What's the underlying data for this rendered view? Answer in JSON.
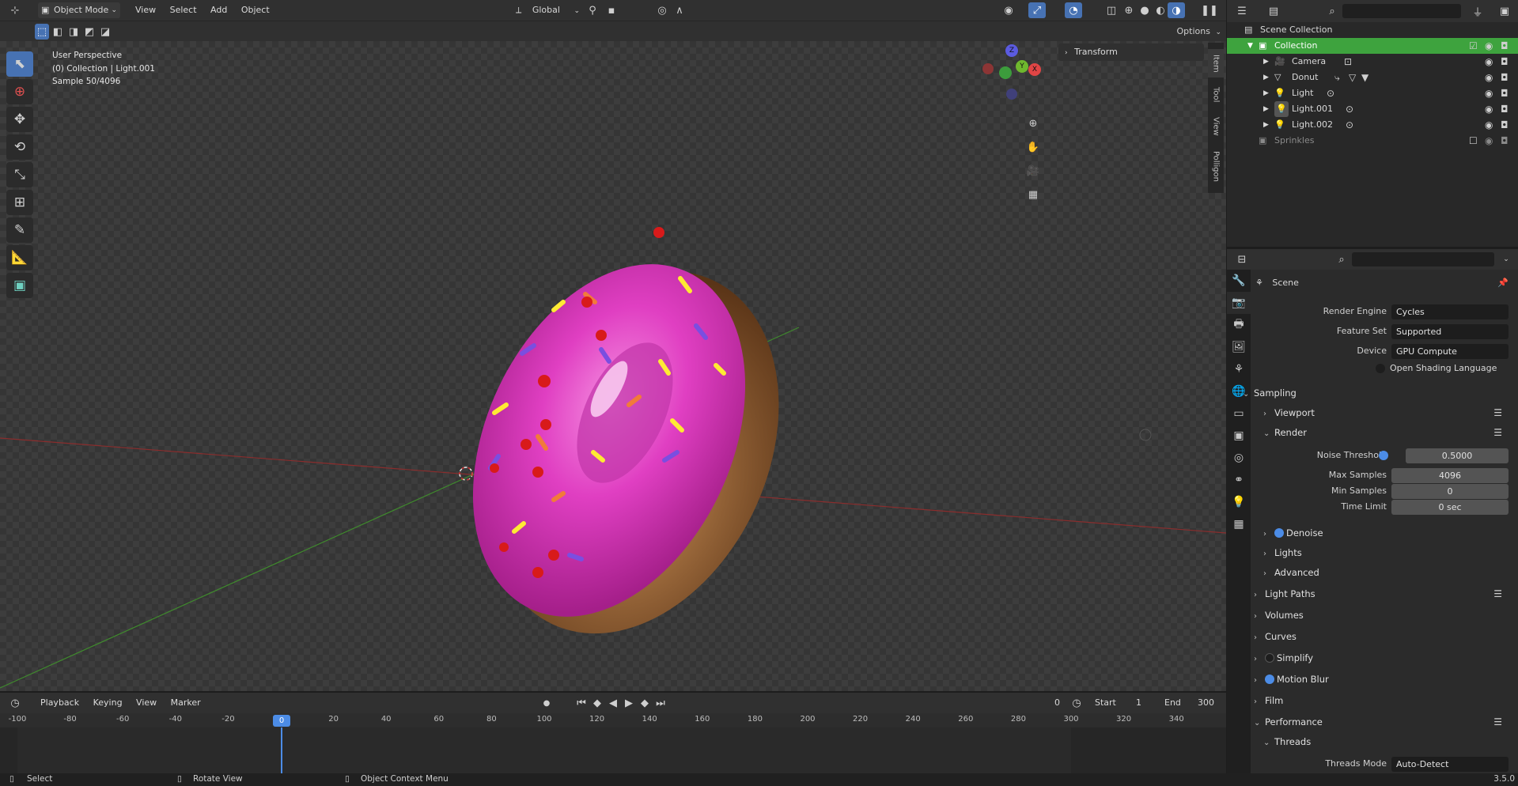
{
  "topbar": {
    "mode": "Object Mode",
    "menus": [
      "View",
      "Select",
      "Add",
      "Object"
    ],
    "orientation": "Global",
    "options_label": "Options"
  },
  "viewport": {
    "info_line1": "User Perspective",
    "info_line2": "(0) Collection | Light.001",
    "info_line3": "Sample 50/4096",
    "transform_panel": "Transform",
    "side_tabs": [
      "Item",
      "Tool",
      "View",
      "Polligon"
    ],
    "gizmo": {
      "z": "Z",
      "y": "Y",
      "x": "X"
    }
  },
  "outliner": {
    "root": "Scene Collection",
    "collection": "Collection",
    "items": [
      "Camera",
      "Donut",
      "Light",
      "Light.001",
      "Light.002"
    ],
    "excluded": "Sprinkles"
  },
  "properties": {
    "header": "Scene",
    "render_engine_label": "Render Engine",
    "render_engine": "Cycles",
    "feature_set_label": "Feature Set",
    "feature_set": "Supported",
    "device_label": "Device",
    "device": "GPU Compute",
    "osl": "Open Shading Language",
    "sampling": "Sampling",
    "viewport": "Viewport",
    "render": "Render",
    "noise_threshold_label": "Noise Threshold",
    "noise_threshold": "0.5000",
    "max_samples_label": "Max Samples",
    "max_samples": "4096",
    "min_samples_label": "Min Samples",
    "min_samples": "0",
    "time_limit_label": "Time Limit",
    "time_limit": "0 sec",
    "denoise": "Denoise",
    "lights": "Lights",
    "advanced": "Advanced",
    "light_paths": "Light Paths",
    "volumes": "Volumes",
    "curves": "Curves",
    "simplify": "Simplify",
    "motion_blur": "Motion Blur",
    "film": "Film",
    "performance": "Performance",
    "threads": "Threads",
    "threads_mode_label": "Threads Mode",
    "threads_mode": "Auto-Detect"
  },
  "timeline": {
    "menus": [
      "Playback",
      "Keying",
      "View",
      "Marker"
    ],
    "current_frame": "0",
    "start_label": "Start",
    "start": "1",
    "end_label": "End",
    "end": "300",
    "ruler": [
      "-100",
      "-80",
      "-60",
      "-40",
      "-20",
      "0",
      "20",
      "40",
      "60",
      "80",
      "100",
      "120",
      "140",
      "160",
      "180",
      "200",
      "220",
      "240",
      "260",
      "280",
      "300",
      "320",
      "340"
    ]
  },
  "status": {
    "select": "Select",
    "rotate": "Rotate View",
    "context": "Object Context Menu",
    "version": "3.5.0"
  },
  "colors": {
    "accent": "#4772b3",
    "collection_highlight": "#3ea33e",
    "frame_indicator": "#4c8ce6",
    "donut_icing": "#e03fc2"
  }
}
